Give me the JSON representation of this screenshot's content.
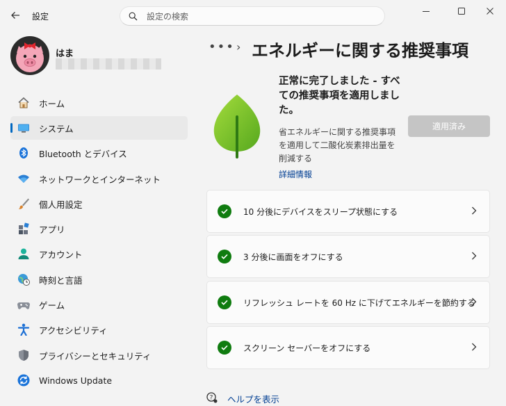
{
  "app_title": "設定",
  "search": {
    "placeholder": "設定の検索"
  },
  "user": {
    "name": "はま"
  },
  "sidebar": {
    "items": [
      {
        "label": "ホーム",
        "icon": "home-icon"
      },
      {
        "label": "システム",
        "icon": "system-icon",
        "selected": true
      },
      {
        "label": "Bluetooth とデバイス",
        "icon": "bluetooth-icon"
      },
      {
        "label": "ネットワークとインターネット",
        "icon": "wifi-icon"
      },
      {
        "label": "個人用設定",
        "icon": "brush-icon"
      },
      {
        "label": "アプリ",
        "icon": "apps-icon"
      },
      {
        "label": "アカウント",
        "icon": "account-icon"
      },
      {
        "label": "時刻と言語",
        "icon": "globe-clock-icon"
      },
      {
        "label": "ゲーム",
        "icon": "gamepad-icon"
      },
      {
        "label": "アクセシビリティ",
        "icon": "accessibility-icon"
      },
      {
        "label": "プライバシーとセキュリティ",
        "icon": "shield-icon"
      },
      {
        "label": "Windows Update",
        "icon": "update-icon"
      }
    ]
  },
  "header": {
    "more": "•••",
    "separator": "›",
    "title": "エネルギーに関する推奨事項"
  },
  "status": {
    "title": "正常に完了しました - すべての推奨事項を適用しました。",
    "description": "省エネルギーに関する推奨事項を適用して二酸化炭素排出量を削減する",
    "details_link": "詳細情報",
    "button_label": "適用済み"
  },
  "recommendations": [
    {
      "text": "10 分後にデバイスをスリープ状態にする"
    },
    {
      "text": "3 分後に画面をオフにする"
    },
    {
      "text": "リフレッシュ レートを 60 Hz に下げてエネルギーを節約する"
    },
    {
      "text": "スクリーン セーバーをオフにする"
    }
  ],
  "help": {
    "label": "ヘルプを表示"
  },
  "colors": {
    "accent": "#0067c0",
    "check": "#107c10",
    "leaf": "#7cc22a",
    "link": "#003e92"
  }
}
